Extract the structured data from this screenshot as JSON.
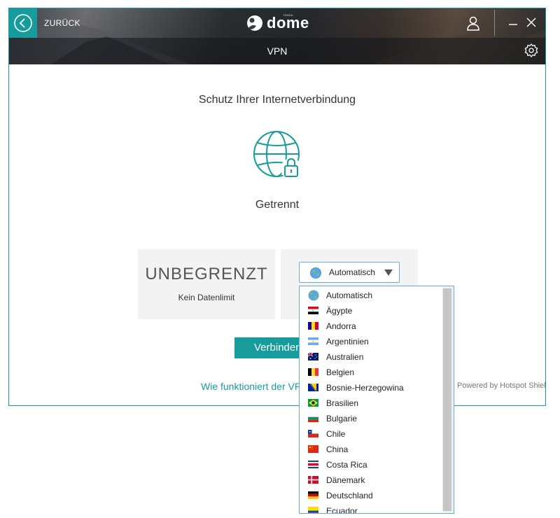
{
  "header": {
    "back_label": "ZURÜCK",
    "logo_brand": "dome",
    "logo_small": "PANDA",
    "title": "VPN"
  },
  "main": {
    "heading": "Schutz Ihrer Internetverbindung",
    "status": "Getrennt",
    "data_card": {
      "value": "UNBEGRENZT",
      "caption": "Kein Datenlimit"
    },
    "location_select": {
      "selected": "Automatisch"
    },
    "connect_button": "Verbinden",
    "help_link": "Wie funktioniert der VPN?",
    "powered_by": "Powered by Hotspot Shield"
  },
  "dropdown": {
    "items": [
      {
        "label": "Automatisch",
        "icon": "globe-icon"
      },
      {
        "label": "Ägypte",
        "icon": "flag-egypt"
      },
      {
        "label": "Andorra",
        "icon": "flag-andorra"
      },
      {
        "label": "Argentinien",
        "icon": "flag-argentina"
      },
      {
        "label": "Australien",
        "icon": "flag-australia"
      },
      {
        "label": "Belgien",
        "icon": "flag-belgium"
      },
      {
        "label": "Bosnie-Herzegowina",
        "icon": "flag-bosnia"
      },
      {
        "label": "Brasilien",
        "icon": "flag-brazil"
      },
      {
        "label": "Bulgarie",
        "icon": "flag-bulgaria"
      },
      {
        "label": "Chile",
        "icon": "flag-chile"
      },
      {
        "label": "China",
        "icon": "flag-china"
      },
      {
        "label": "Costa Rica",
        "icon": "flag-costa-rica"
      },
      {
        "label": "Dänemark",
        "icon": "flag-denmark"
      },
      {
        "label": "Deutschland",
        "icon": "flag-germany"
      },
      {
        "label": "Ecuador",
        "icon": "flag-ecuador"
      }
    ]
  },
  "colors": {
    "accent": "#169c9c",
    "dropdown_border": "#6aaed6"
  }
}
